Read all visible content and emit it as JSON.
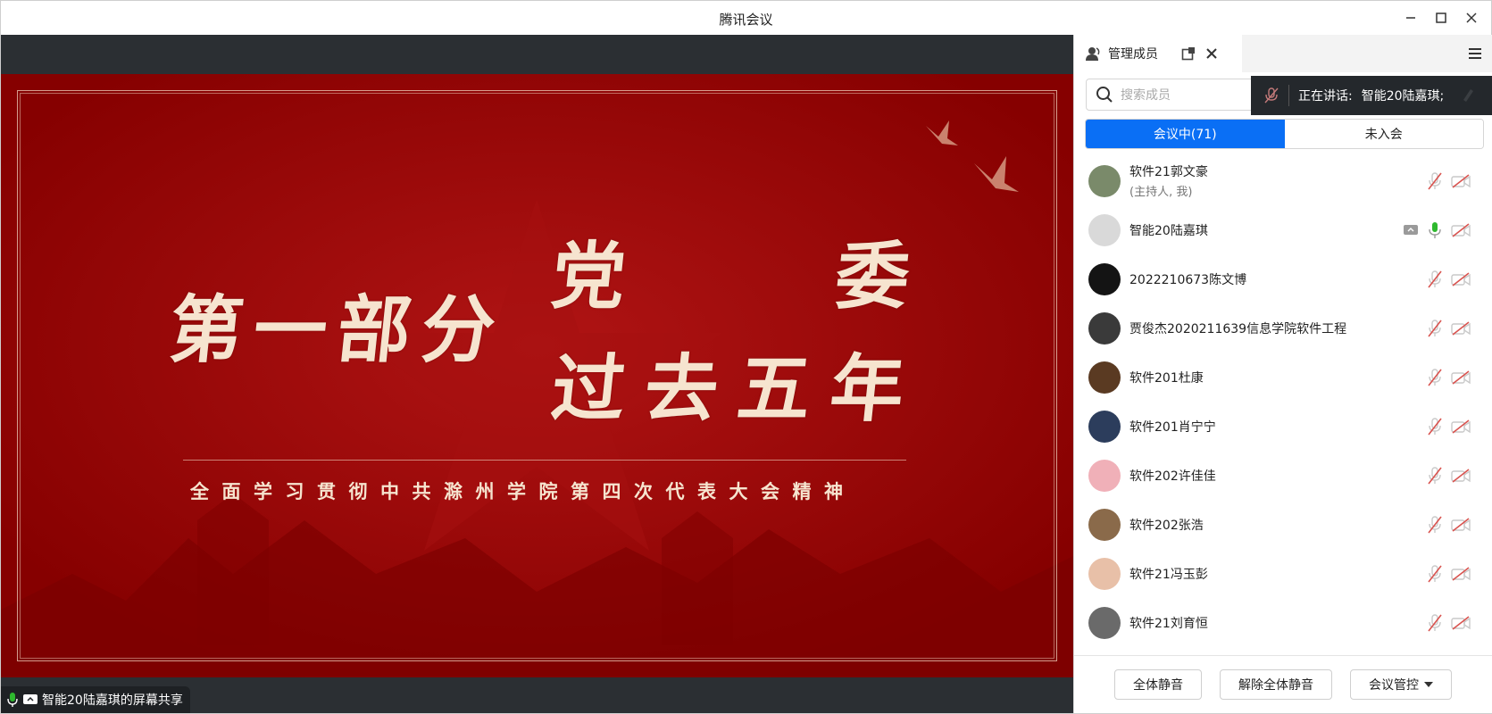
{
  "window": {
    "title": "腾讯会议"
  },
  "slide": {
    "line1": "第一部分",
    "line2a": "党",
    "line2b": "委",
    "line3": "过去五年",
    "subtitle": "全面学习贯彻中共滁州学院第四次代表大会精神"
  },
  "share_status": {
    "text": "智能20陆嘉琪的屏幕共享"
  },
  "panel": {
    "tab_label": "管理成员",
    "search_placeholder": "搜索成员",
    "speaking_label": "正在讲话:",
    "speaking_name": "智能20陆嘉琪;",
    "tab_in_meeting": "会议中(71)",
    "tab_not_joined": "未入会",
    "members": [
      {
        "name": "软件21郭文豪",
        "sub": "(主持人, 我)",
        "avatar": "#7a8a6a",
        "mic": "muted",
        "share": false
      },
      {
        "name": "智能20陆嘉琪",
        "sub": "",
        "avatar": "#d9d9d9",
        "mic": "active",
        "share": true
      },
      {
        "name": "2022210673陈文博",
        "sub": "",
        "avatar": "#141414",
        "mic": "muted",
        "share": false
      },
      {
        "name": "贾俊杰2020211639信息学院软件工程",
        "sub": "",
        "avatar": "#3a3a3a",
        "mic": "muted",
        "share": false
      },
      {
        "name": "软件201杜康",
        "sub": "",
        "avatar": "#5a3a22",
        "mic": "muted",
        "share": false
      },
      {
        "name": "软件201肖宁宁",
        "sub": "",
        "avatar": "#2c3d5c",
        "mic": "muted",
        "share": false
      },
      {
        "name": "软件202许佳佳",
        "sub": "",
        "avatar": "#f0b0b8",
        "mic": "muted",
        "share": false
      },
      {
        "name": "软件202张浩",
        "sub": "",
        "avatar": "#8a6a4a",
        "mic": "muted",
        "share": false
      },
      {
        "name": "软件21冯玉彭",
        "sub": "",
        "avatar": "#e8c0a8",
        "mic": "muted",
        "share": false
      },
      {
        "name": "软件21刘育恒",
        "sub": "",
        "avatar": "#6a6a6a",
        "mic": "muted",
        "share": false
      }
    ],
    "footer": {
      "mute_all": "全体静音",
      "unmute_all": "解除全体静音",
      "controls": "会议管控"
    }
  },
  "colors": {
    "accent": "#0a6ff5",
    "slide_red": "#8c0000",
    "mic_active": "#2eb82e",
    "muted_red": "#d9534f"
  }
}
